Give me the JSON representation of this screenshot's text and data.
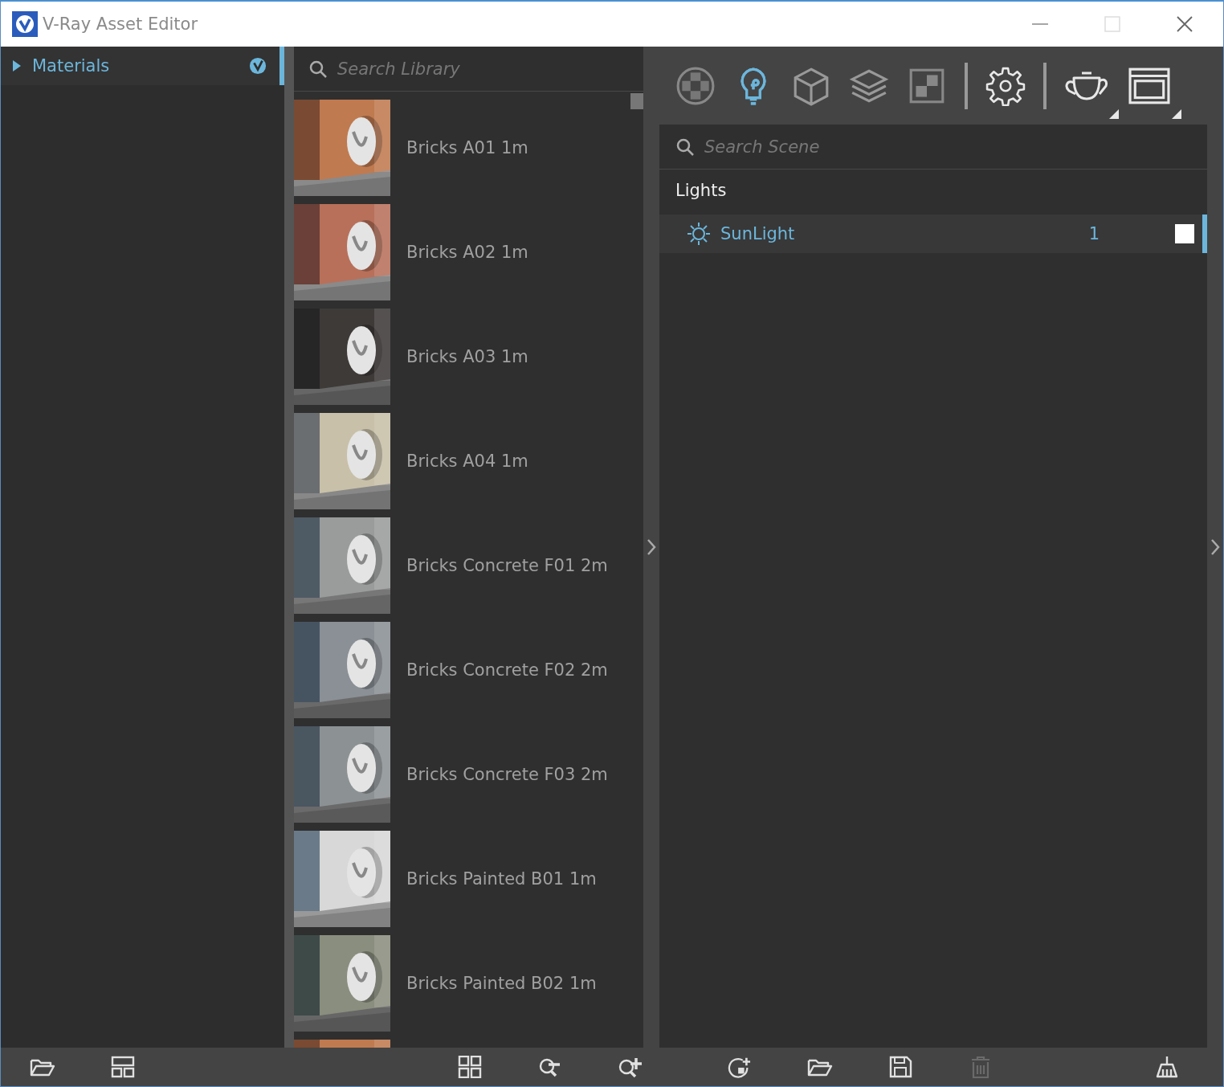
{
  "window": {
    "title": "V-Ray Asset Editor"
  },
  "categories": {
    "items": [
      {
        "label": "Materials",
        "expanded": false,
        "selected": true
      }
    ]
  },
  "library": {
    "search": {
      "placeholder": "Search Library"
    },
    "items": [
      {
        "name": "Bricks A01 1m"
      },
      {
        "name": "Bricks A02 1m"
      },
      {
        "name": "Bricks A03 1m"
      },
      {
        "name": "Bricks A04 1m"
      },
      {
        "name": "Bricks Concrete F01 2m"
      },
      {
        "name": "Bricks Concrete F02 2m"
      },
      {
        "name": "Bricks Concrete F03 2m"
      },
      {
        "name": "Bricks Painted B01 1m"
      },
      {
        "name": "Bricks Painted B02 1m"
      }
    ]
  },
  "toolbar": [
    {
      "kind": "materials",
      "selected": false
    },
    {
      "kind": "lights",
      "selected": true
    },
    {
      "kind": "geometry",
      "selected": false
    },
    {
      "kind": "layers",
      "selected": false
    },
    {
      "kind": "textures",
      "selected": false
    },
    {
      "kind": "separator"
    },
    {
      "kind": "settings",
      "selected": false
    },
    {
      "kind": "separator"
    },
    {
      "kind": "render",
      "selected": false
    },
    {
      "kind": "frame-buffer",
      "selected": false
    }
  ],
  "scene": {
    "search": {
      "placeholder": "Search Scene"
    },
    "section": "Lights",
    "items": [
      {
        "name": "SunLight",
        "count": "1",
        "color": "#ffffff",
        "selected": true
      }
    ]
  },
  "bottom_toolbar": {
    "left": [
      {
        "kind": "open",
        "disabled": false
      },
      {
        "kind": "layout",
        "disabled": false
      }
    ],
    "middle": [
      {
        "kind": "grid",
        "disabled": false
      },
      {
        "kind": "zoom-out",
        "disabled": false
      },
      {
        "kind": "zoom-in",
        "disabled": false
      }
    ],
    "right": [
      {
        "kind": "add-material",
        "disabled": false
      },
      {
        "kind": "open",
        "disabled": false
      },
      {
        "kind": "save",
        "disabled": false
      },
      {
        "kind": "delete",
        "disabled": true
      },
      {
        "kind": "purge",
        "disabled": false
      }
    ]
  }
}
